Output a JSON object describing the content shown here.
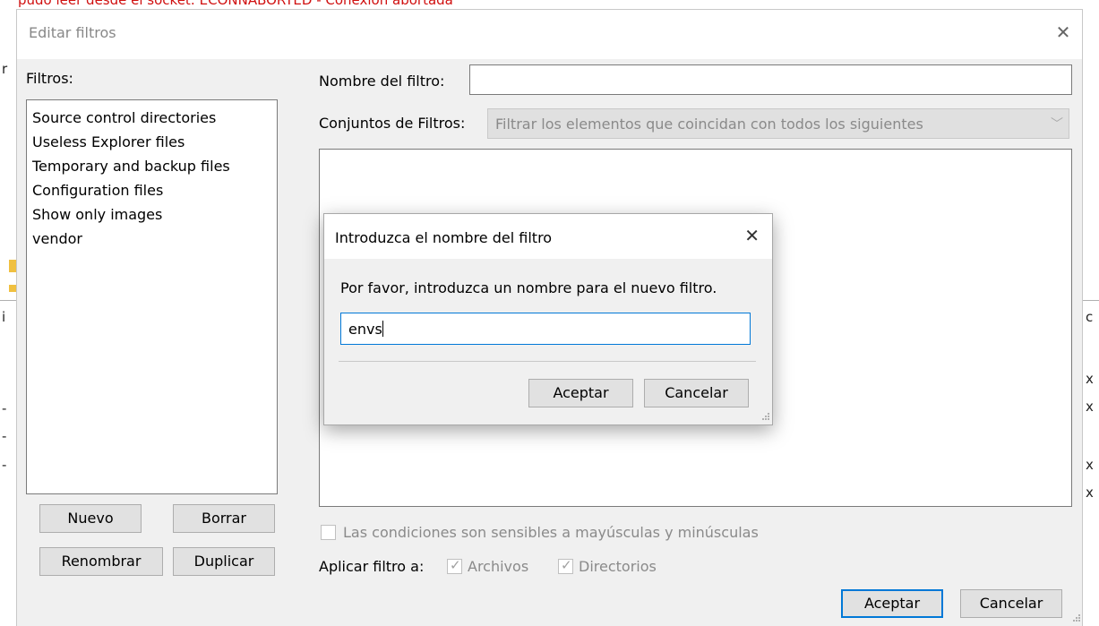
{
  "background": {
    "status_text": "pudo leer desde el socket: ECONNABORTED - Conexión abortada"
  },
  "dialog": {
    "title": "Editar filtros",
    "filters_label": "Filtros:",
    "filters": [
      "Source control directories",
      "Useless Explorer files",
      "Temporary and backup files",
      "Configuration files",
      "Show only images",
      "vendor"
    ],
    "name_label": "Nombre del filtro:",
    "name_value": "",
    "sets_label": "Conjuntos de Filtros:",
    "sets_value": "Filtrar los elementos que coincidan con todos los siguientes",
    "buttons": {
      "nuevo": "Nuevo",
      "borrar": "Borrar",
      "renombrar": "Renombrar",
      "duplicar": "Duplicar",
      "aceptar": "Aceptar",
      "cancelar": "Cancelar"
    },
    "case_sensitive_label": "Las condiciones son sensibles a mayúsculas y minúsculas",
    "apply_label": "Aplicar filtro a:",
    "apply_files": "Archivos",
    "apply_dirs": "Directorios"
  },
  "modal": {
    "title": "Introduzca el nombre del filtro",
    "prompt": "Por favor, introduzca un nombre para el nuevo filtro.",
    "input_value": "envs",
    "accept": "Aceptar",
    "cancel": "Cancelar"
  },
  "colors": {
    "accent": "#0078d7",
    "error_text": "#d01010"
  }
}
